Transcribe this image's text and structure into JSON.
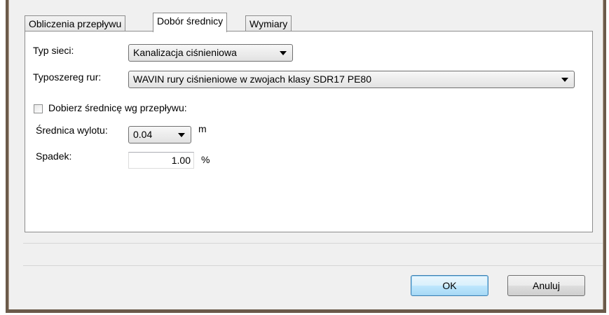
{
  "tabs": [
    {
      "label": "Obliczenia przepływu",
      "active": false
    },
    {
      "label": "Dobór średnicy",
      "active": true
    },
    {
      "label": "Wymiary",
      "active": false
    }
  ],
  "form": {
    "network_type": {
      "label": "Typ sieci:",
      "value": "Kanalizacja ciśnieniowa"
    },
    "pipe_series": {
      "label": "Typoszereg rur:",
      "value": "WAVIN rury ciśnieniowe w zwojach klasy SDR17 PE80"
    },
    "auto_diameter": {
      "label": "Dobierz średnicę wg przepływu:",
      "checked": false
    },
    "outlet_diameter": {
      "label": "Średnica wylotu:",
      "value": "0.04",
      "unit": "m"
    },
    "slope": {
      "label": "Spadek:",
      "value": "1.00",
      "unit": "%"
    }
  },
  "buttons": {
    "ok": "OK",
    "cancel": "Anuluj"
  },
  "colors": {
    "frame": "#6b5a4a",
    "dialog_bg": "#f0f0f0",
    "default_button_border": "#3c7fb1"
  }
}
